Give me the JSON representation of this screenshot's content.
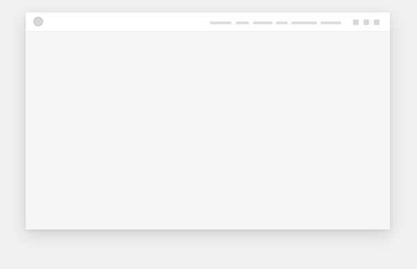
{
  "header": {
    "logo_icon": "circle-logo-icon",
    "nav_items": [
      {
        "label": "",
        "placeholder": true
      },
      {
        "label": "",
        "placeholder": true
      },
      {
        "label": "",
        "placeholder": true
      },
      {
        "label": "",
        "placeholder": true
      },
      {
        "label": "",
        "placeholder": true
      },
      {
        "label": "",
        "placeholder": true
      }
    ],
    "action_icons": [
      "square-icon",
      "square-icon",
      "square-icon"
    ]
  },
  "colors": {
    "page_background": "#f0f0f0",
    "header_background": "#ffffff",
    "content_background": "#f7f7f7",
    "placeholder": "#dddddd"
  }
}
